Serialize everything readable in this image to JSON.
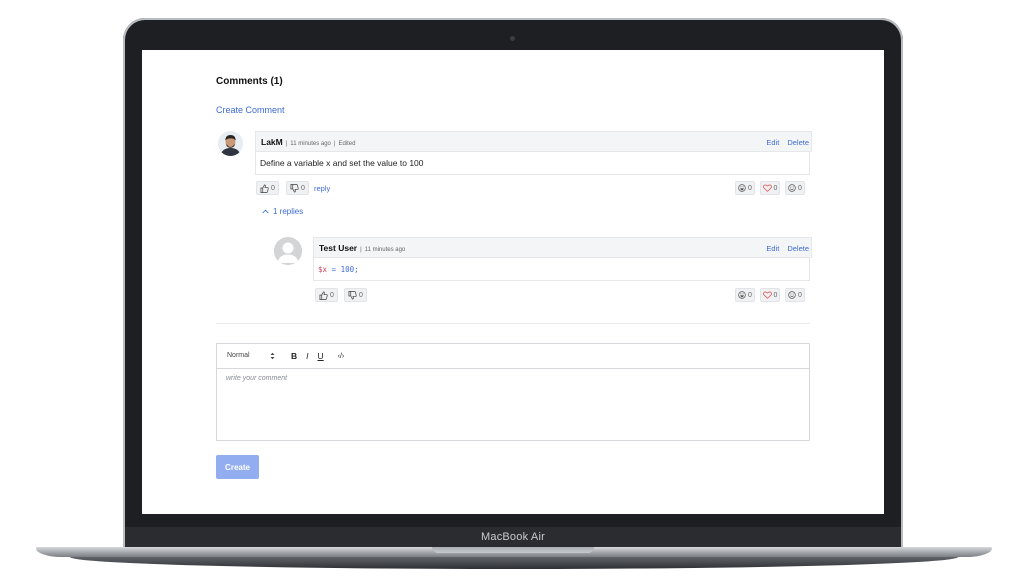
{
  "device": {
    "model_label": "MacBook Air"
  },
  "comments": {
    "title": "Comments (1)",
    "create_link": "Create Comment",
    "thread": {
      "author": "LakM",
      "time": "11 minutes ago",
      "edited": "Edited",
      "edit_label": "Edit",
      "delete_label": "Delete",
      "body": "Define a variable x and set the value to 100",
      "likes": "0",
      "dislikes": "0",
      "reply_label": "reply",
      "replies_toggle": "1 replies",
      "reactions": {
        "laugh": "0",
        "heart": "0",
        "smile": "0"
      }
    },
    "reply": {
      "author": "Test User",
      "time": "11 minutes ago",
      "edit_label": "Edit",
      "delete_label": "Delete",
      "code_var": "$x",
      "code_rest": " = 100;",
      "likes": "0",
      "dislikes": "0",
      "reactions": {
        "laugh": "0",
        "heart": "0",
        "smile": "0"
      }
    }
  },
  "editor": {
    "format_select": "Normal",
    "bold": "B",
    "italic": "I",
    "underline": "U",
    "code": "‹/›",
    "placeholder": "write your comment",
    "submit_label": "Create"
  },
  "colors": {
    "link": "#3d6bd1",
    "heart": "#e05a5a",
    "button": "#93aef0"
  }
}
